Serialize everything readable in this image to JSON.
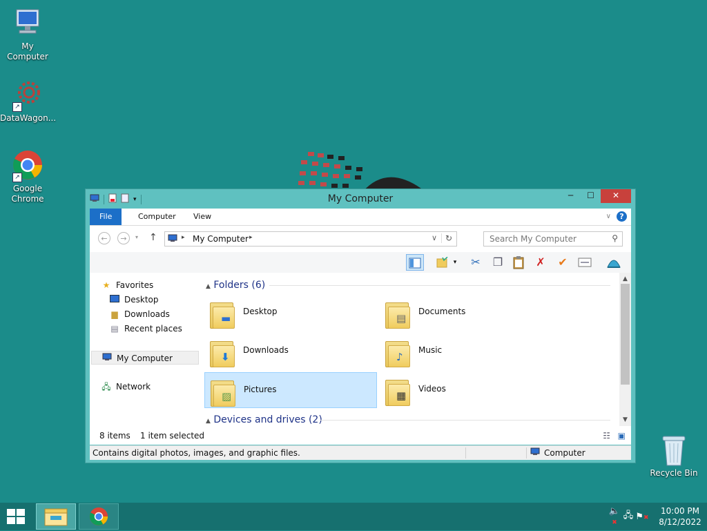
{
  "desktop": {
    "icons": [
      {
        "label": "My Computer"
      },
      {
        "label": "DataWagon..."
      },
      {
        "label": "Google Chrome"
      },
      {
        "label": "Recycle Bin"
      }
    ]
  },
  "window": {
    "title": "My Computer",
    "ribbon_tabs": [
      "File",
      "Computer",
      "View"
    ],
    "address": "My Computer",
    "search_placeholder": "Search My Computer",
    "nav_pane": {
      "favorites": "Favorites",
      "favorites_items": [
        "Desktop",
        "Downloads",
        "Recent places"
      ],
      "my_computer": "My Computer",
      "network": "Network"
    },
    "groups": {
      "folders_header": "Folders (6)",
      "devices_header": "Devices and drives (2)"
    },
    "folders": [
      {
        "name": "Desktop",
        "overlay": "desktop"
      },
      {
        "name": "Documents",
        "overlay": "document"
      },
      {
        "name": "Downloads",
        "overlay": "download"
      },
      {
        "name": "Music",
        "overlay": "music"
      },
      {
        "name": "Pictures",
        "overlay": "picture",
        "selected": true
      },
      {
        "name": "Videos",
        "overlay": "video"
      }
    ],
    "info": {
      "item_count": "8 items",
      "selection": "1 item selected"
    },
    "status": {
      "description": "Contains digital photos, images, and graphic files.",
      "location": "Computer"
    }
  },
  "taskbar": {
    "clock_time": "10:00 PM",
    "clock_date": "8/12/2022"
  },
  "colors": {
    "desktop": "#1b8c8a",
    "window_frame": "#5fc1c0",
    "file_tab": "#1c6fc8",
    "selection": "#cce8ff",
    "close_button": "#c8413c",
    "taskbar": "#16706f"
  }
}
